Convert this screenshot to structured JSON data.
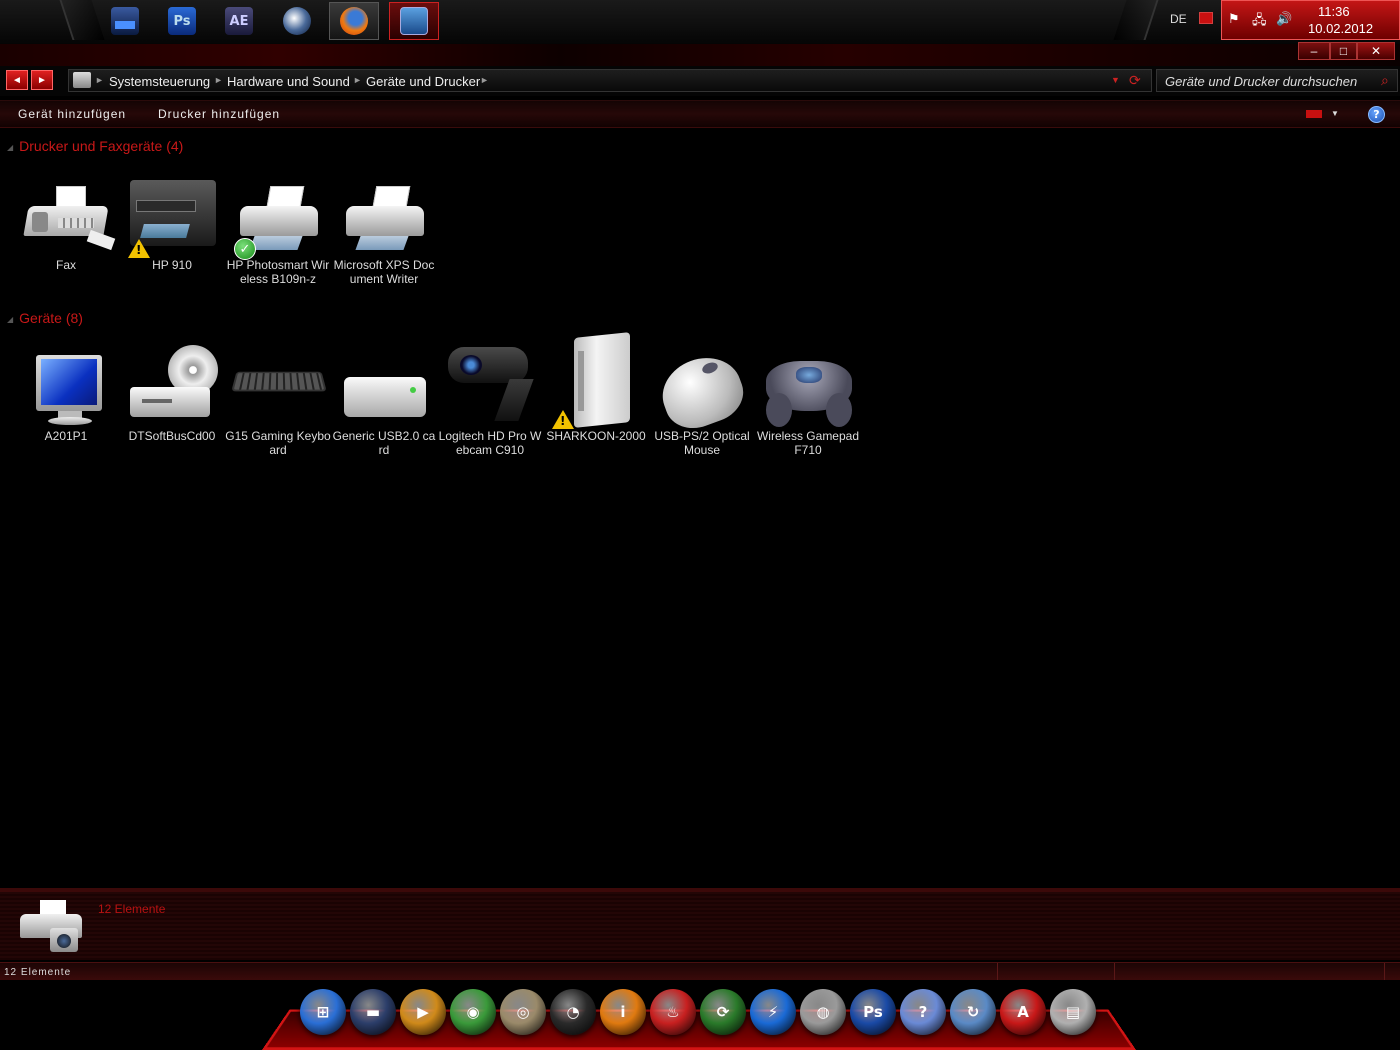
{
  "taskbar": {
    "apps": [
      {
        "name": "window-manager-icon",
        "glyph": ""
      },
      {
        "name": "photoshop-icon",
        "glyph": "Ps"
      },
      {
        "name": "after-effects-icon",
        "glyph": "AE"
      },
      {
        "name": "cinema4d-icon",
        "glyph": ""
      },
      {
        "name": "firefox-icon",
        "glyph": ""
      },
      {
        "name": "explorer-window-icon",
        "glyph": ""
      }
    ],
    "language": "DE",
    "clock_time": "11:36",
    "clock_date": "10.02.2012"
  },
  "window": {
    "minimize_glyph": "–",
    "maximize_glyph": "□",
    "close_glyph": "✕"
  },
  "address": {
    "back_glyph": "◄",
    "forward_glyph": "►",
    "crumbs": [
      "Systemsteuerung",
      "Hardware und Sound",
      "Geräte und Drucker"
    ],
    "search_placeholder": "Geräte und Drucker durchsuchen"
  },
  "commands": {
    "add_device": "Gerät hinzufügen",
    "add_printer": "Drucker hinzufügen",
    "help": "?"
  },
  "groups": {
    "printers": {
      "header": "Drucker und Faxgeräte (4)",
      "items": [
        {
          "label": "Fax",
          "icon": "fax-icon",
          "badge": ""
        },
        {
          "label": "HP 910",
          "icon": "multifunction-printer-icon",
          "badge": "warning"
        },
        {
          "label": "HP Photosmart Wireless B109n-z",
          "icon": "printer-icon",
          "badge": "default"
        },
        {
          "label": "Microsoft XPS Document Writer",
          "icon": "printer-icon",
          "badge": ""
        }
      ]
    },
    "devices": {
      "header": "Geräte (8)",
      "items": [
        {
          "label": "A201P1",
          "icon": "monitor-icon",
          "badge": ""
        },
        {
          "label": "DTSoftBusCd00",
          "icon": "cd-drive-icon",
          "badge": ""
        },
        {
          "label": "G15 Gaming Keyboard",
          "icon": "keyboard-icon",
          "badge": ""
        },
        {
          "label": "Generic USB2.0 card",
          "icon": "usb-drive-icon",
          "badge": ""
        },
        {
          "label": "Logitech HD Pro Webcam C910",
          "icon": "webcam-icon",
          "badge": ""
        },
        {
          "label": "SHARKOON-2000",
          "icon": "external-drive-icon",
          "badge": "warning"
        },
        {
          "label": "USB-PS/2 Optical Mouse",
          "icon": "mouse-icon",
          "badge": ""
        },
        {
          "label": "Wireless Gamepad F710",
          "icon": "gamepad-icon",
          "badge": ""
        }
      ]
    }
  },
  "details": {
    "count": "12 Elemente"
  },
  "status": {
    "text": "12 Elemente"
  },
  "dock": [
    {
      "name": "windows-start-icon",
      "glyph": "⊞",
      "color": "#2a6fd6"
    },
    {
      "name": "window-manager-icon",
      "glyph": "▬",
      "color": "#2c3e6a"
    },
    {
      "name": "media-player-icon",
      "glyph": "▶",
      "color": "#d08a1a"
    },
    {
      "name": "chrome-icon",
      "glyph": "◉",
      "color": "#3a9a3a"
    },
    {
      "name": "disc-burner-icon",
      "glyph": "◎",
      "color": "#9a8a6a"
    },
    {
      "name": "speedometer-icon",
      "glyph": "◔",
      "color": "#2a2a2a"
    },
    {
      "name": "info-icon",
      "glyph": "i",
      "color": "#e07a10"
    },
    {
      "name": "fire-icon",
      "glyph": "♨",
      "color": "#c82020"
    },
    {
      "name": "globe-arrow-icon",
      "glyph": "⟳",
      "color": "#2a7a2a"
    },
    {
      "name": "lightning-icon",
      "glyph": "⚡",
      "color": "#1a6ad6"
    },
    {
      "name": "webcam-icon",
      "glyph": "◍",
      "color": "#9a9a9a"
    },
    {
      "name": "photoshop-icon",
      "glyph": "Ps",
      "color": "#1a4aa6"
    },
    {
      "name": "help-tool-icon",
      "glyph": "?",
      "color": "#6a8ad6"
    },
    {
      "name": "sync-icon",
      "glyph": "↻",
      "color": "#5a8ac6"
    },
    {
      "name": "acrobat-icon",
      "glyph": "A",
      "color": "#c81818"
    },
    {
      "name": "printer-icon",
      "glyph": "▤",
      "color": "#b0b0b0"
    }
  ]
}
